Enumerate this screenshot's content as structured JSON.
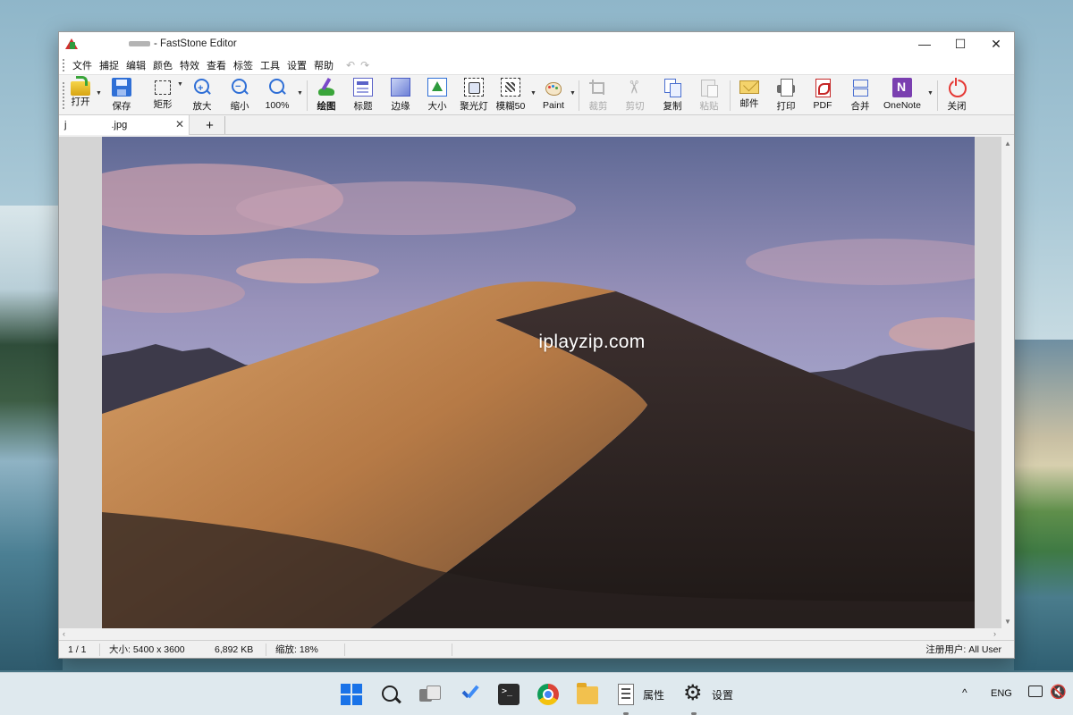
{
  "window": {
    "title": "FastStone Editor",
    "controls": {
      "minimize": "—",
      "maximize": "☐",
      "close": "✕"
    }
  },
  "menu": [
    "文件",
    "捕捉",
    "编辑",
    "颜色",
    "特效",
    "查看",
    "标签",
    "工具",
    "设置",
    "帮助"
  ],
  "menu_extra": {
    "undo": "↶",
    "redo": "↷"
  },
  "toolbar": {
    "open": "打开",
    "save": "保存",
    "rect": "矩形",
    "zoom_in": "放大",
    "zoom_out": "缩小",
    "zoom_pct": "100%",
    "draw": "绘图",
    "title": "标题",
    "edge": "边缘",
    "size": "大小",
    "spotlight": "聚光灯",
    "blur": "模糊50",
    "paint": "Paint",
    "crop": "裁剪",
    "cut": "剪切",
    "copy": "复制",
    "paste": "粘贴",
    "email": "邮件",
    "print": "打印",
    "pdf": "PDF",
    "merge": "合并",
    "onenote": "OneNote",
    "close": "关闭"
  },
  "tabs": {
    "name_start": "j",
    "name_end": ".jpg",
    "close": "✕",
    "add": "+"
  },
  "image": {
    "watermark": "iplayzip.com"
  },
  "status": {
    "page": "1 / 1",
    "size_label": "大小:",
    "size_value": "5400 x 3600",
    "file_size": "6,892 KB",
    "zoom_label": "缩放:",
    "zoom_value": "18%",
    "user": "注册用户: All User"
  },
  "taskbar": {
    "props_label": "属性",
    "settings_label": "设置",
    "lang": "ENG",
    "caret": "^"
  },
  "colors": {
    "accent": "#1a73e8",
    "window_bg": "#f0f0f0",
    "viewer_bg": "#d4d4d4"
  }
}
